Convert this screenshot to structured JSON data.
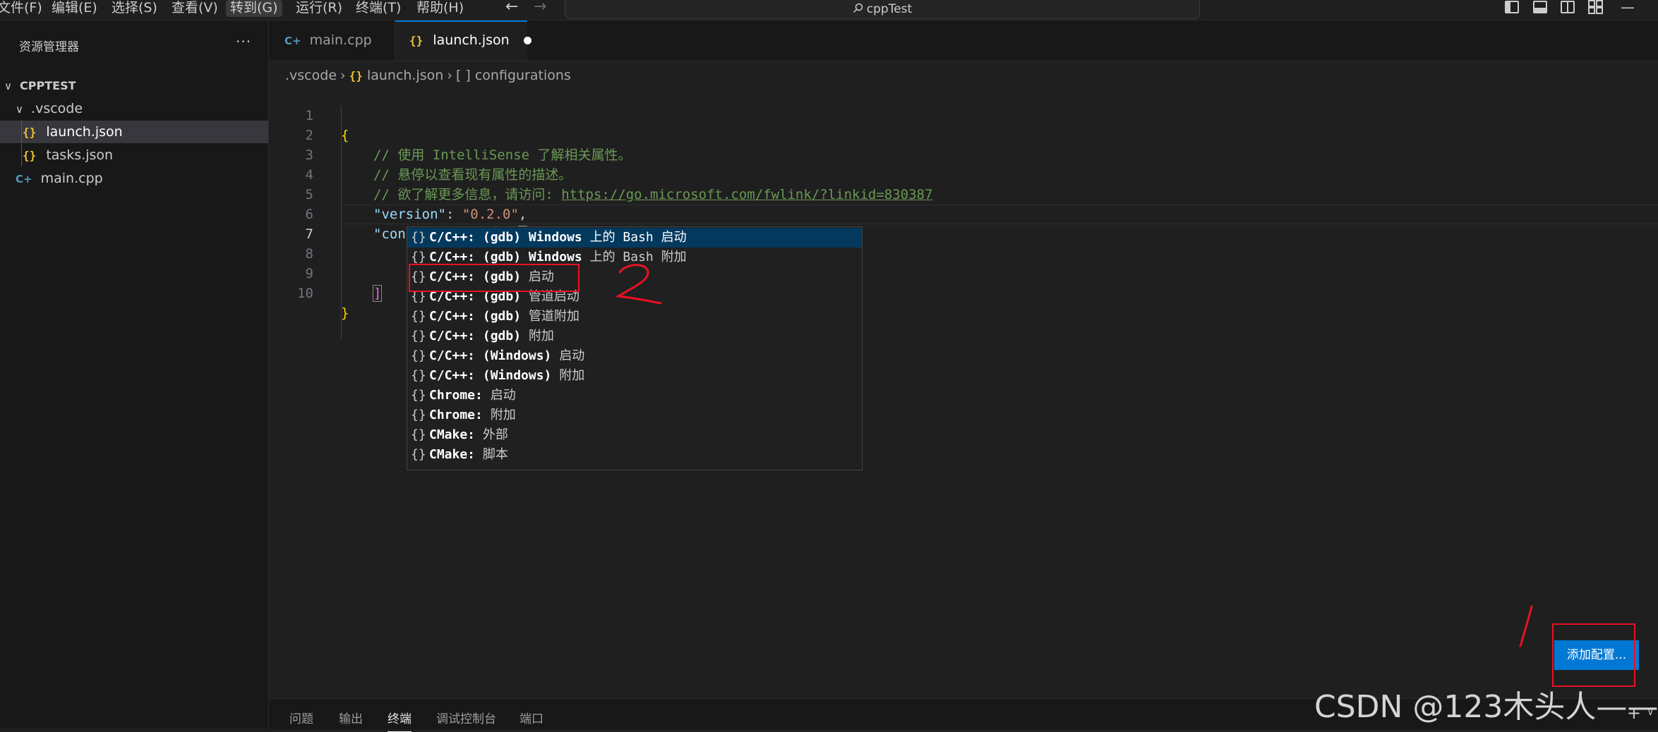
{
  "menu": {
    "items": [
      "文件(F)",
      "编辑(E)",
      "选择(S)",
      "查看(V)",
      "转到(G)",
      "运行(R)",
      "终端(T)",
      "帮助(H)"
    ],
    "active_index": 4
  },
  "command_center": {
    "text": "cppTest"
  },
  "sidebar": {
    "title": "资源管理器",
    "more": "···",
    "project": "CPPTEST",
    "folder": ".vscode",
    "files": {
      "launch": "launch.json",
      "tasks": "tasks.json",
      "main": "main.cpp"
    }
  },
  "tabs": {
    "main": "main.cpp",
    "launch": "launch.json"
  },
  "breadcrumb": {
    "folder": ".vscode",
    "file": "launch.json",
    "symbol_icon": "[ ]",
    "symbol": "configurations"
  },
  "editor": {
    "line_numbers": [
      "1",
      "2",
      "3",
      "4",
      "5",
      "6",
      "7",
      "8",
      "9",
      "10"
    ],
    "lines": {
      "l1": "{",
      "l2": "// 使用 IntelliSense 了解相关属性。",
      "l3": "// 悬停以查看现有属性的描述。",
      "l4_prefix": "// 欲了解更多信息，请访问: ",
      "l4_link": "https://go.microsoft.com/fwlink/?linkid=830387",
      "l5_key": "\"version\"",
      "l5_colon": ": ",
      "l5_value": "\"0.2.0\"",
      "l5_comma": ",",
      "l6_key": "\"configurations\"",
      "l6_colon": ": ",
      "l6_bracket": "[",
      "l9": "]",
      "l10": "}"
    }
  },
  "suggestions": {
    "icon": "{}",
    "focused_index": 0,
    "items": [
      {
        "bold": "C/C++: (gdb) Windows",
        "rest": " 上的 Bash 启动"
      },
      {
        "bold": "C/C++: (gdb) Windows",
        "rest": " 上的 Bash 附加"
      },
      {
        "bold": "C/C++: (gdb)",
        "rest": " 启动"
      },
      {
        "bold": "C/C++: (gdb)",
        "rest": " 管道启动"
      },
      {
        "bold": "C/C++: (gdb)",
        "rest": " 管道附加"
      },
      {
        "bold": "C/C++: (gdb)",
        "rest": " 附加"
      },
      {
        "bold": "C/C++: (Windows)",
        "rest": " 启动"
      },
      {
        "bold": "C/C++: (Windows)",
        "rest": " 附加"
      },
      {
        "bold": "Chrome:",
        "rest": " 启动"
      },
      {
        "bold": "Chrome:",
        "rest": " 附加"
      },
      {
        "bold": "CMake:",
        "rest": " 外部"
      },
      {
        "bold": "CMake:",
        "rest": " 脚本"
      }
    ]
  },
  "panel": {
    "tabs": [
      "问题",
      "输出",
      "终端",
      "调试控制台",
      "端口"
    ],
    "active_index": 2,
    "plus": "+",
    "chevron": "∨"
  },
  "add_config_button": "添加配置...",
  "annotations": {
    "mark_1": "1",
    "mark_2": "2",
    "color": "#e81123"
  },
  "watermark": "CSDN @123木头人——",
  "colors": {
    "accent": "#0078d4",
    "json_icon": "#e8c337",
    "cpp_icon": "#519aba",
    "suggest_focus": "#04395e"
  }
}
